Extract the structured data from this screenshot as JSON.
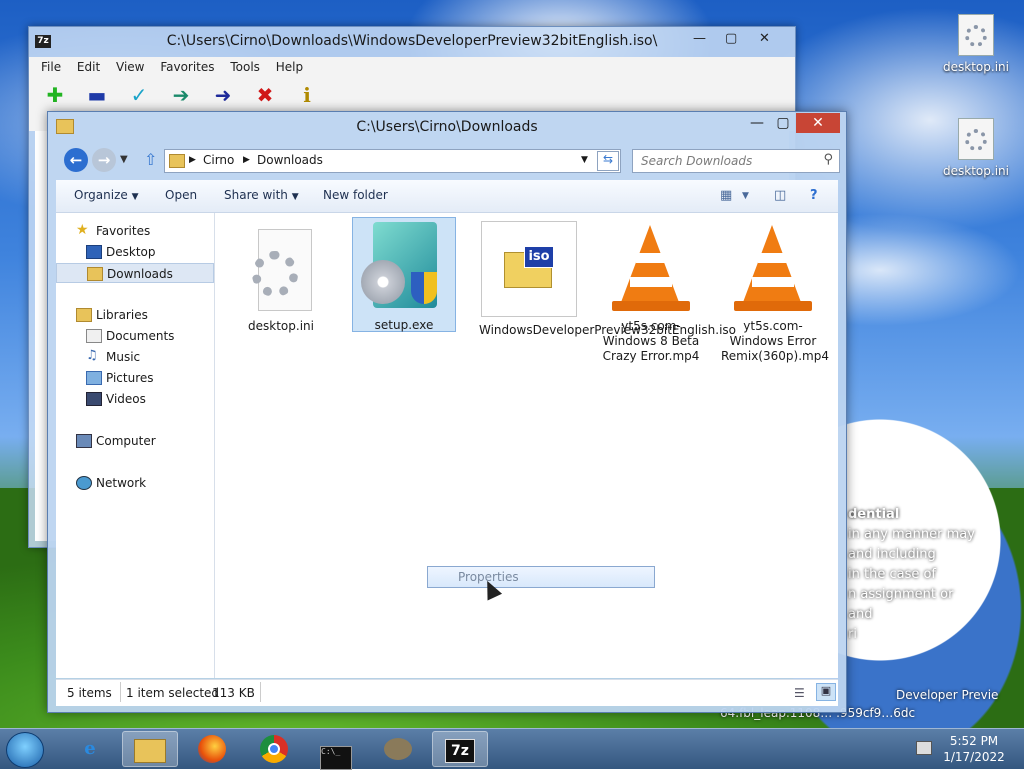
{
  "desktop": {
    "icons": [
      {
        "label": "desktop.ini"
      },
      {
        "label": "desktop.ini"
      }
    ],
    "bg_text_heading": "dential",
    "bg_text_lines": [
      "in any manner may",
      "and including",
      "in the case of",
      "n assignment or",
      "and",
      "ri"
    ],
    "bg_text_footer1": "Developer Previe",
    "bg_text_footer2": "64.fbl_leap.1108… .959cf9…6dc"
  },
  "zip_window": {
    "title": "C:\\Users\\Cirno\\Downloads\\WindowsDeveloperPreview32bitEnglish.iso\\",
    "app_icon": "7z",
    "menu": [
      "File",
      "Edit",
      "View",
      "Favorites",
      "Tools",
      "Help"
    ],
    "tools": [
      {
        "icon": "add-icon",
        "color": "#22b422"
      },
      {
        "icon": "extract-icon",
        "color": "#1e3aa8"
      },
      {
        "icon": "test-icon",
        "color": "#19a3c8"
      },
      {
        "icon": "copy-icon",
        "color": "#1a8a6a"
      },
      {
        "icon": "move-icon",
        "color": "#1e2a9a"
      },
      {
        "icon": "delete-icon",
        "color": "#d01818"
      },
      {
        "icon": "info-icon",
        "color": "#b08a00"
      }
    ]
  },
  "explorer": {
    "title": "C:\\Users\\Cirno\\Downloads",
    "breadcrumb": [
      "Cirno",
      "Downloads"
    ],
    "search_placeholder": "Search Downloads",
    "commands": [
      "Organize",
      "Open",
      "Share with",
      "New folder"
    ],
    "nav": [
      {
        "label": "Favorites",
        "selected": false
      },
      {
        "label": "Desktop",
        "selected": false
      },
      {
        "label": "Downloads",
        "selected": true
      },
      {
        "label": "Libraries",
        "selected": false
      },
      {
        "label": "Documents",
        "selected": false
      },
      {
        "label": "Music",
        "selected": false
      },
      {
        "label": "Pictures",
        "selected": false
      },
      {
        "label": "Videos",
        "selected": false
      },
      {
        "label": "Computer",
        "selected": false
      },
      {
        "label": "Network",
        "selected": false
      }
    ],
    "files": [
      {
        "name": "desktop.ini",
        "type": "ini",
        "selected": false
      },
      {
        "name": "setup.exe",
        "type": "exe",
        "selected": true
      },
      {
        "name": "WindowsDeveloperPreview32bitEnglish.iso",
        "type": "iso",
        "selected": false
      },
      {
        "name": "yt5s.com-Windows 8 Beta Crazy Error.mp4",
        "type": "vlc",
        "selected": false
      },
      {
        "name": "yt5s.com-Windows Error Remix(360p).mp4",
        "type": "vlc",
        "selected": false
      }
    ],
    "status": {
      "item_count": "5 items",
      "selection": "1 item selected",
      "size": "113 KB"
    },
    "tooltip": "Properties",
    "iso_badge": "iso"
  },
  "taskbar": {
    "time": "5:52 PM",
    "date": "1/17/2022",
    "items": [
      "internet-explorer-icon",
      "file-explorer-icon",
      "firefox-icon",
      "chrome-icon",
      "cmd-icon",
      "gimp-icon",
      "7zip-icon"
    ],
    "active_item": "file-explorer-icon",
    "cmd_label": "C:\\_",
    "zip_label": "7z"
  },
  "colors": {
    "close_button": "#c84535",
    "selection": "#cde3f7",
    "taskbar": "#34577f"
  }
}
